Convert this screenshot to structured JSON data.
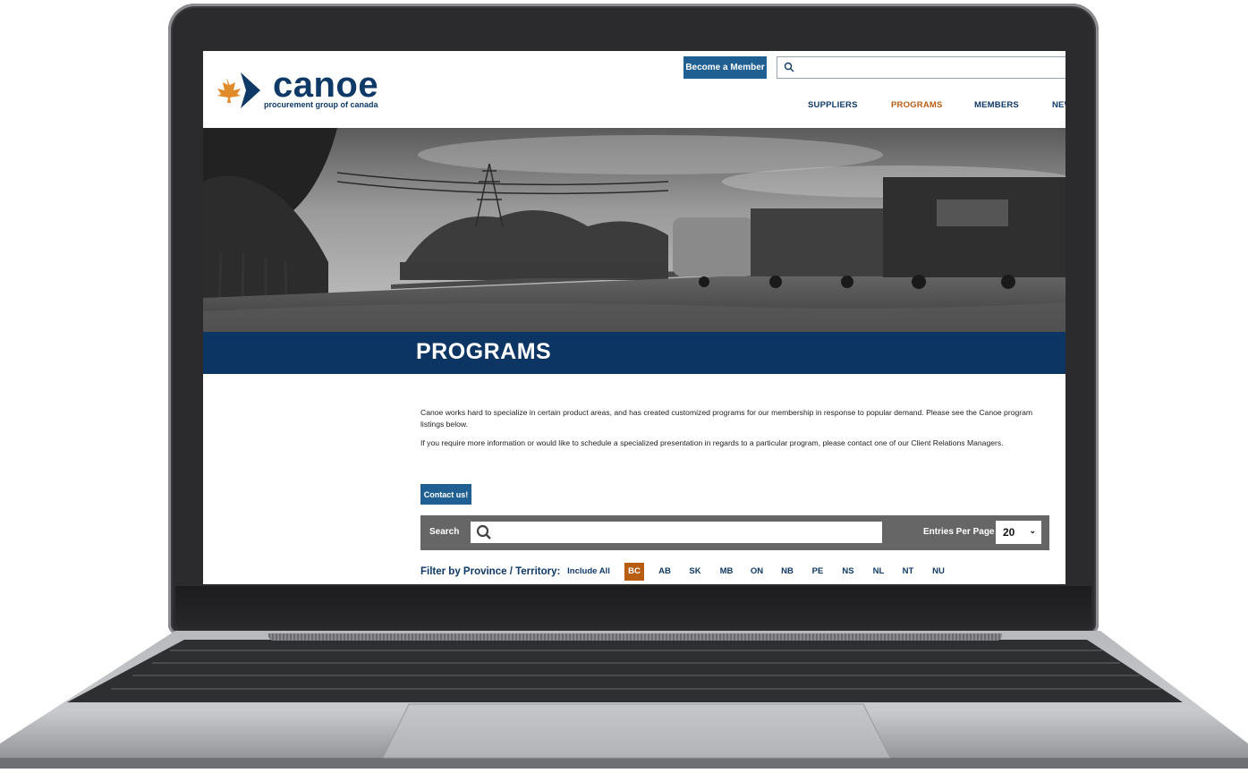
{
  "header": {
    "logo_wordmark": "canoe",
    "logo_tagline": "procurement group of canada",
    "become_member_label": "Become a Member",
    "nav": [
      {
        "label": "SUPPLIERS",
        "active": false
      },
      {
        "label": "PROGRAMS",
        "active": true
      },
      {
        "label": "MEMBERS",
        "active": false
      },
      {
        "label": "NEW",
        "active": false
      }
    ]
  },
  "page": {
    "title": "PROGRAMS",
    "intro_1": "Canoe works hard to specialize in certain product areas, and has created customized programs for our membership in response to popular demand. Please see the Canoe program listings below.",
    "intro_2": "If you require more information or would like to schedule a specialized presentation in regards to a particular program, please contact one of our Client Relations Managers.",
    "contact_label": "Contact us!"
  },
  "search": {
    "label": "Search",
    "value": "",
    "entries_label": "Entries Per Page",
    "entries_value": "20"
  },
  "filter": {
    "label": "Filter by Province / Territory:",
    "options": [
      {
        "label": "Include All",
        "active": false
      },
      {
        "label": "BC",
        "active": true
      },
      {
        "label": "AB",
        "active": false
      },
      {
        "label": "SK",
        "active": false
      },
      {
        "label": "MB",
        "active": false
      },
      {
        "label": "ON",
        "active": false
      },
      {
        "label": "NB",
        "active": false
      },
      {
        "label": "PE",
        "active": false
      },
      {
        "label": "NS",
        "active": false
      },
      {
        "label": "NL",
        "active": false
      },
      {
        "label": "NT",
        "active": false
      },
      {
        "label": "NU",
        "active": false
      }
    ]
  },
  "colors": {
    "navy": "#0d3564",
    "button_blue": "#1f5f91",
    "accent_orange": "#b75d14",
    "search_bar_gray": "#666666"
  },
  "icons": [
    "canoe-logo-icon",
    "search-icon",
    "chevron-down-icon"
  ]
}
